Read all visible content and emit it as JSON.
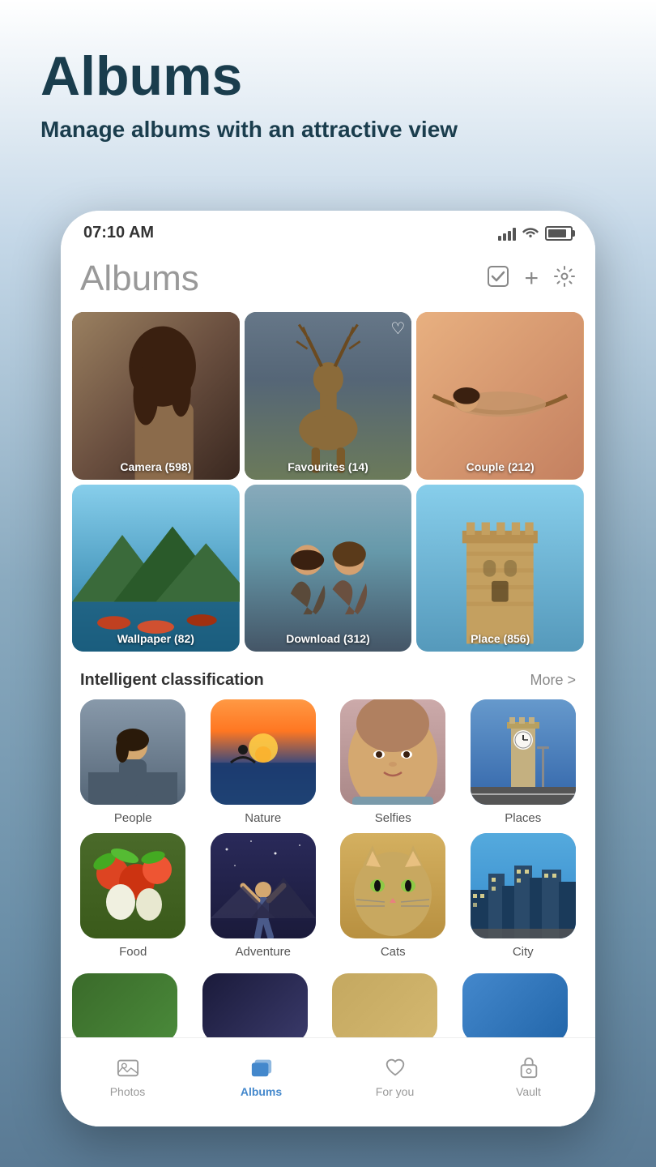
{
  "page": {
    "title": "Albums",
    "subtitle": "Manage albums with an attractive view"
  },
  "status_bar": {
    "time": "07:10 AM"
  },
  "app_header": {
    "title": "Albums",
    "actions": {
      "select_icon": "✓",
      "add_icon": "+",
      "settings_icon": "⚙"
    }
  },
  "albums": [
    {
      "id": "camera",
      "label": "Camera (598)",
      "class": "album-camera"
    },
    {
      "id": "favourites",
      "label": "Favourites (14)",
      "class": "album-favourites",
      "heart": "♥"
    },
    {
      "id": "couple",
      "label": "Couple (212)",
      "class": "album-couple"
    },
    {
      "id": "wallpaper",
      "label": "Wallpaper (82)",
      "class": "album-wallpaper"
    },
    {
      "id": "download",
      "label": "Download (312)",
      "class": "album-download"
    },
    {
      "id": "place",
      "label": "Place (856)",
      "class": "album-place"
    }
  ],
  "intelligent_classification": {
    "title": "Intelligent classification",
    "more_label": "More >",
    "items": [
      {
        "id": "people",
        "label": "People",
        "class": "class-people"
      },
      {
        "id": "nature",
        "label": "Nature",
        "class": "class-nature"
      },
      {
        "id": "selfies",
        "label": "Selfies",
        "class": "class-selfies"
      },
      {
        "id": "places",
        "label": "Places",
        "class": "class-places"
      },
      {
        "id": "food",
        "label": "Food",
        "class": "class-food"
      },
      {
        "id": "adventure",
        "label": "Adventure",
        "class": "class-adventure"
      },
      {
        "id": "cats",
        "label": "Cats",
        "class": "class-cats"
      },
      {
        "id": "city",
        "label": "City",
        "class": "class-city"
      }
    ]
  },
  "bottom_nav": {
    "items": [
      {
        "id": "photos",
        "label": "Photos",
        "active": false
      },
      {
        "id": "albums",
        "label": "Albums",
        "active": true
      },
      {
        "id": "foryou",
        "label": "For you",
        "active": false
      },
      {
        "id": "vault",
        "label": "Vault",
        "active": false
      }
    ]
  },
  "colors": {
    "active_nav": "#4488cc",
    "inactive_nav": "#999999",
    "title_dark": "#1a3d4d"
  }
}
